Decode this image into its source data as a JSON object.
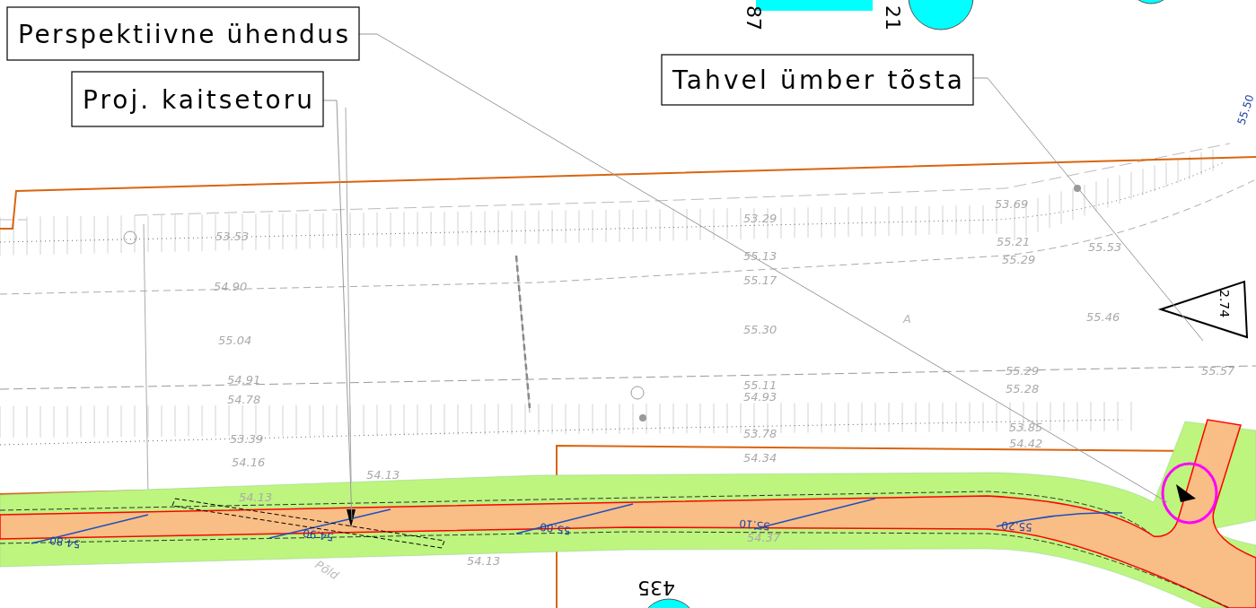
{
  "callouts": [
    {
      "text": "Perspektiivne ühendus"
    },
    {
      "text": "Proj. kaitsetoru"
    },
    {
      "text": "Tahvel ümber tõsta"
    }
  ],
  "sign_numbers": [
    "87",
    "21",
    "435"
  ],
  "survey_elevations": [
    "53.53",
    "54.90",
    "55.04",
    "54.91",
    "54.78",
    "53.39",
    "54.16",
    "54.13",
    "54.13",
    "54.13",
    "53.29",
    "55.13",
    "55.17",
    "55.30",
    "53.69",
    "55.21",
    "55.29",
    "55.53",
    "55.46",
    "55.57",
    "55.29",
    "55.28",
    "55.11",
    "54.93",
    "53.78",
    "54.34",
    "53.85",
    "54.42",
    "54.37"
  ],
  "design_elevations": [
    "54.80",
    "54.90",
    "55.00",
    "55.10",
    "55.20",
    "55.50"
  ],
  "dimension_labels": [
    "2.74"
  ],
  "point_labels": [
    "A"
  ],
  "area_labels": [
    "Põld"
  ]
}
